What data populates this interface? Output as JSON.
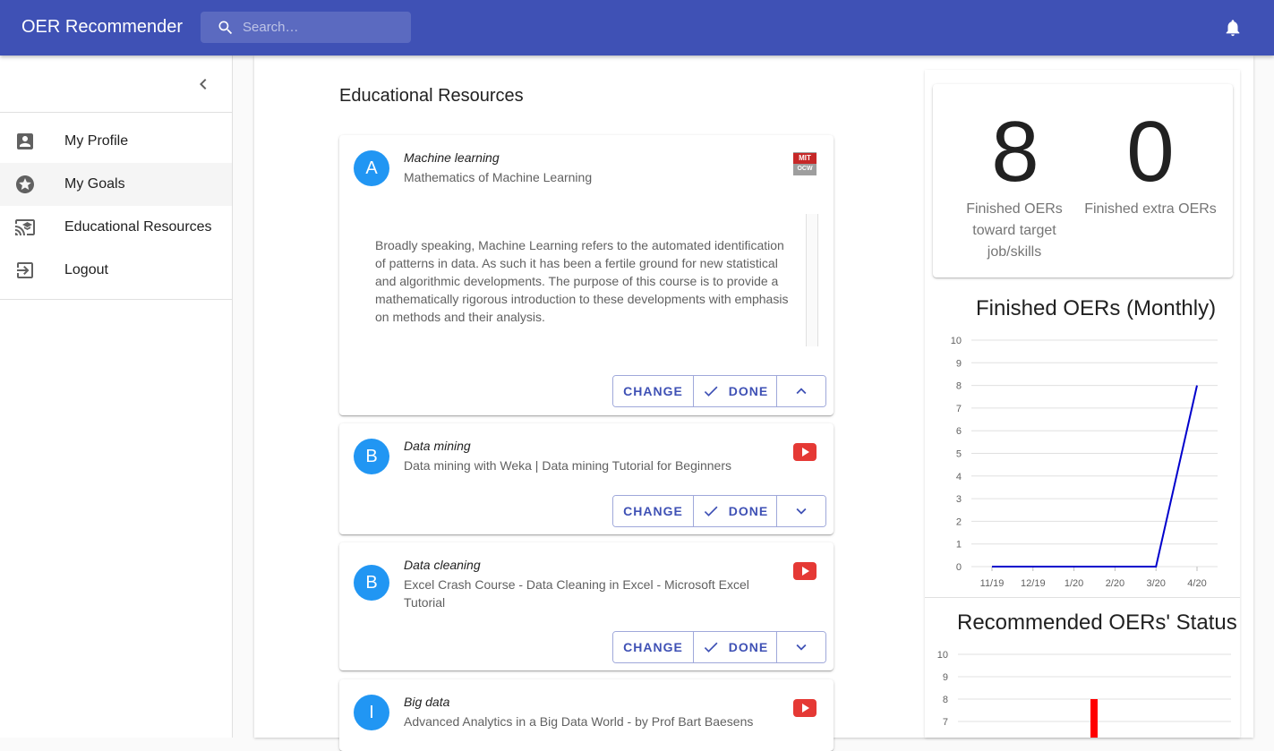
{
  "app": {
    "title": "OER Recommender"
  },
  "search": {
    "placeholder": "Search…"
  },
  "nav": {
    "items": [
      {
        "label": "My Profile",
        "icon": "account-box-icon"
      },
      {
        "label": "My Goals",
        "icon": "star-circle-icon",
        "active": true
      },
      {
        "label": "Educational Resources",
        "icon": "cast-for-education-icon"
      },
      {
        "label": "Logout",
        "icon": "exit-to-app-icon"
      }
    ]
  },
  "main": {
    "title": "Educational Resources",
    "buttons": {
      "change": "CHANGE",
      "done": "DONE"
    },
    "resources": [
      {
        "avatar": "A",
        "topic": "Machine learning",
        "title": "Mathematics of Machine Learning",
        "provider": "mit-ocw-icon",
        "provider_text": [
          "MIT",
          "OCW"
        ],
        "description": "Broadly speaking, Machine Learning refers to the automated identification of patterns in data. As such it has been a fertile ground for new statistical and algorithmic developments. The purpose of this course is to provide a mathematically rigorous introduction to these developments with emphasis on methods and their analysis.",
        "expanded": true
      },
      {
        "avatar": "B",
        "topic": "Data mining",
        "title": "Data mining with Weka | Data mining Tutorial for Beginners",
        "provider": "youtube-icon",
        "expanded": false
      },
      {
        "avatar": "B",
        "topic": "Data cleaning",
        "title": "Excel Crash Course - Data Cleaning in Excel - Microsoft Excel Tutorial",
        "provider": "youtube-icon",
        "expanded": false
      },
      {
        "avatar": "I",
        "topic": "Big data",
        "title": "Advanced Analytics in a Big Data World - by Prof Bart Baesens",
        "provider": "youtube-icon",
        "expanded": false
      }
    ]
  },
  "stats": {
    "finished_target": {
      "value": "8",
      "label": "Finished OERs toward target job/skills"
    },
    "finished_extra": {
      "value": "0",
      "label": "Finished extra OERs"
    }
  },
  "colors": {
    "primary": "#3f51b5",
    "avatar": "#2196f3",
    "line": "#0000cc",
    "bar": "#ff0000",
    "youtube": "#e53935"
  },
  "chart_data": [
    {
      "type": "line",
      "title": "Finished OERs (Monthly)",
      "categories": [
        "11/19",
        "12/19",
        "1/20",
        "2/20",
        "3/20",
        "4/20"
      ],
      "values": [
        0,
        0,
        0,
        0,
        0,
        8
      ],
      "yticks": [
        0,
        1,
        2,
        3,
        4,
        5,
        6,
        7,
        8,
        9,
        10
      ],
      "ylim": [
        0,
        10
      ],
      "grid": true
    },
    {
      "type": "bar",
      "title": "Recommended OERs' Status",
      "yticks": [
        7,
        8,
        9,
        10
      ],
      "ylim": [
        0,
        10
      ],
      "values": [
        8
      ],
      "grid": true
    }
  ]
}
